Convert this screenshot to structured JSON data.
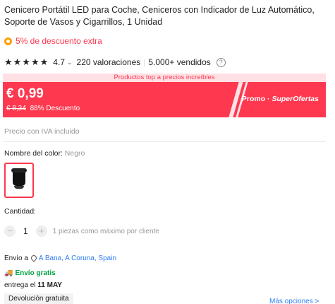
{
  "product": {
    "title": "Cenicero Portátil LED para Coche, Ceniceros con Indicador de Luz Automático, Soporte de Vasos y Cigarrillos, 1 Unidad"
  },
  "coupon": {
    "text": "5% de descuento extra"
  },
  "rating": {
    "stars": "★★★★★",
    "score": "4.7",
    "chevron": "⌄",
    "reviews": "220 valoraciones",
    "separator": "|",
    "sold": "5.000+ vendidos",
    "help": "?"
  },
  "promo": {
    "banner": "Productos top a precios increíbles",
    "price": "€ 0,99",
    "original_price": "€ 8,34",
    "discount": "88% Descuento",
    "brand_prefix": "Promo · ",
    "brand_name": "SuperOfertas",
    "color": "#fd384f"
  },
  "tax_note": "Precio con IVA incluido",
  "color_option": {
    "label": "Nombre del color: ",
    "value": "Negro"
  },
  "quantity": {
    "label": "Cantidad:",
    "minus": "−",
    "value": "1",
    "plus": "+",
    "max_note": "1 piezas como máximo por cliente"
  },
  "shipping": {
    "to_label": "Envío a",
    "location": "A Bana, A Coruna, Spain",
    "free_label": "Envío gratis",
    "delivery_prefix": "entrega el ",
    "delivery_date": "11 MAY",
    "returns": "Devolución gratuita",
    "more_options": "Más opciones >"
  }
}
